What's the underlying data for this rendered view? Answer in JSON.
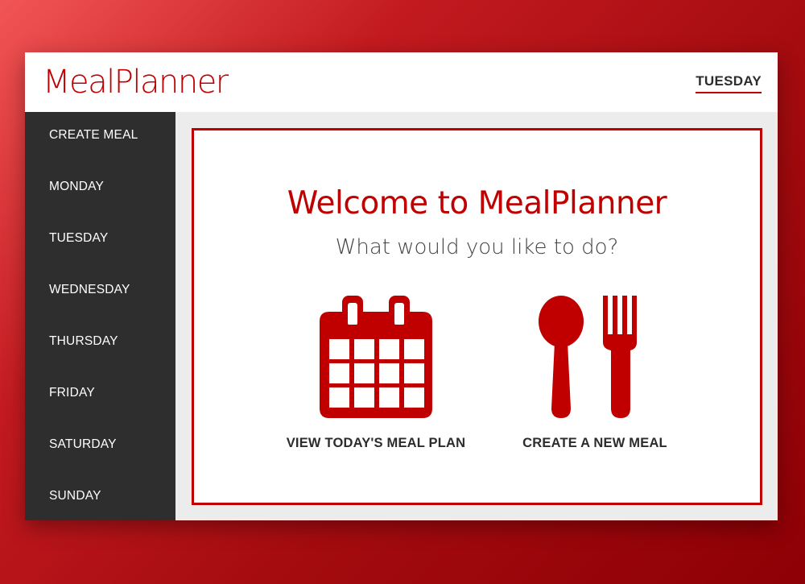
{
  "app": {
    "brand": "MealPlanner",
    "current_day": "TUESDAY"
  },
  "sidebar": {
    "items": [
      {
        "label": "CREATE MEAL"
      },
      {
        "label": "MONDAY"
      },
      {
        "label": "TUESDAY"
      },
      {
        "label": "WEDNESDAY"
      },
      {
        "label": "THURSDAY"
      },
      {
        "label": "FRIDAY"
      },
      {
        "label": "SATURDAY"
      },
      {
        "label": "SUNDAY"
      }
    ]
  },
  "main": {
    "welcome": "Welcome to MealPlanner",
    "subtitle": "What would you like to do?",
    "actions": [
      {
        "label": "VIEW TODAY'S MEAL PLAN",
        "icon": "calendar-icon"
      },
      {
        "label": "CREATE A NEW MEAL",
        "icon": "spoon-fork-icon"
      }
    ]
  },
  "colors": {
    "accent": "#c00000",
    "sidebar_bg": "#2e2e2e",
    "content_bg": "#ececec"
  }
}
